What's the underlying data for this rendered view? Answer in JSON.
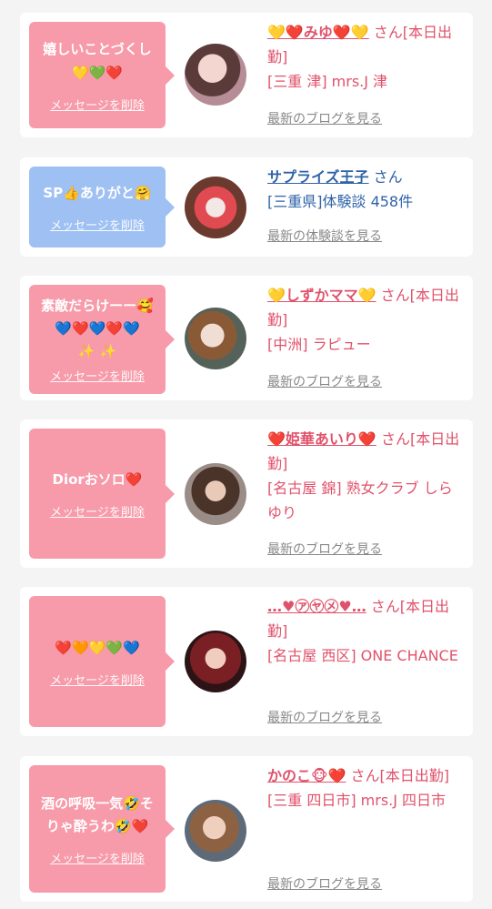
{
  "cards": [
    {
      "message": "嬉しいことづくし\n💛💚❤️",
      "delete_label": "メッセージを削除",
      "name": "💛❤️みゆ❤️💛",
      "honorific": " さん[本日出勤]",
      "shop": "[三重 津] mrs.J 津",
      "blog": "最新のブログを見る",
      "bubble_color": "#f79aa9"
    },
    {
      "message": "SP👍ありがと🤗",
      "delete_label": "メッセージを削除",
      "name": "サプライズ王子",
      "honorific": " さん",
      "shop": "[三重県]体験談 458件",
      "blog": "最新の体験談を見る",
      "bubble_color": "#9ec0f2"
    },
    {
      "message": "素敵だらけーー🥰\n💙❤️💙❤️💙\n✨ ✨",
      "delete_label": "メッセージを削除",
      "name": "💛しずかママ💛",
      "honorific": " さん[本日出勤]",
      "shop": "[中洲] ラピュー",
      "blog": "最新のブログを見る",
      "bubble_color": "#f79aa9"
    },
    {
      "message": "Diorおソロ❤️",
      "delete_label": "メッセージを削除",
      "name": "❤️姫華あいり❤️",
      "honorific": " さん[本日出勤]",
      "shop": "[名古屋 錦] 熟女クラブ しらゆり",
      "blog": "最新のブログを見る",
      "bubble_color": "#f79aa9"
    },
    {
      "message": "❤️🧡💛💚💙",
      "delete_label": "メッセージを削除",
      "name": "…♥︎㋐㋳㋱♥︎…",
      "honorific": " さん[本日出勤]",
      "shop": "[名古屋 西区] ONE CHANCE",
      "blog": "最新のブログを見る",
      "bubble_color": "#f79aa9"
    },
    {
      "message": "酒の呼吸一気🤣そりゃ酔うわ🤣❤️",
      "delete_label": "メッセージを削除",
      "name": "かのこ🐵❤️",
      "honorific": " さん[本日出勤]",
      "shop": "[三重 四日市] mrs.J 四日市",
      "blog": "最新のブログを見る",
      "bubble_color": "#f79aa9"
    }
  ]
}
